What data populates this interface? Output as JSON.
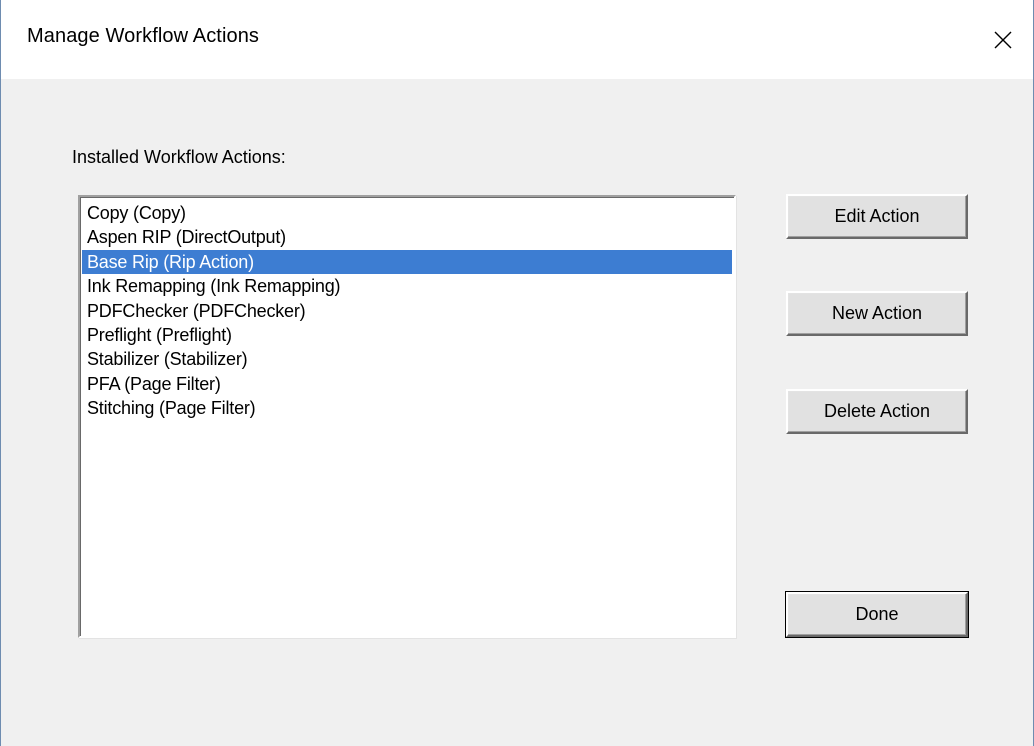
{
  "window": {
    "title": "Manage Workflow Actions",
    "close_label": "close"
  },
  "body": {
    "list_label": "Installed Workflow Actions:"
  },
  "actions_list": {
    "items": [
      "Copy (Copy)",
      "Aspen RIP (DirectOutput)",
      "Base Rip (Rip Action)",
      "Ink Remapping (Ink Remapping)",
      "PDFChecker (PDFChecker)",
      "Preflight (Preflight)",
      "Stabilizer (Stabilizer)",
      "PFA (Page Filter)",
      "Stitching (Page Filter)"
    ],
    "selected_index": 2
  },
  "buttons": {
    "edit": "Edit Action",
    "new": "New Action",
    "delete": "Delete Action",
    "done": "Done"
  },
  "colors": {
    "selection": "#3d7dd2",
    "background": "#f0f0f0",
    "titlebar": "#ffffff"
  },
  "icons": {
    "close": "close-icon"
  }
}
